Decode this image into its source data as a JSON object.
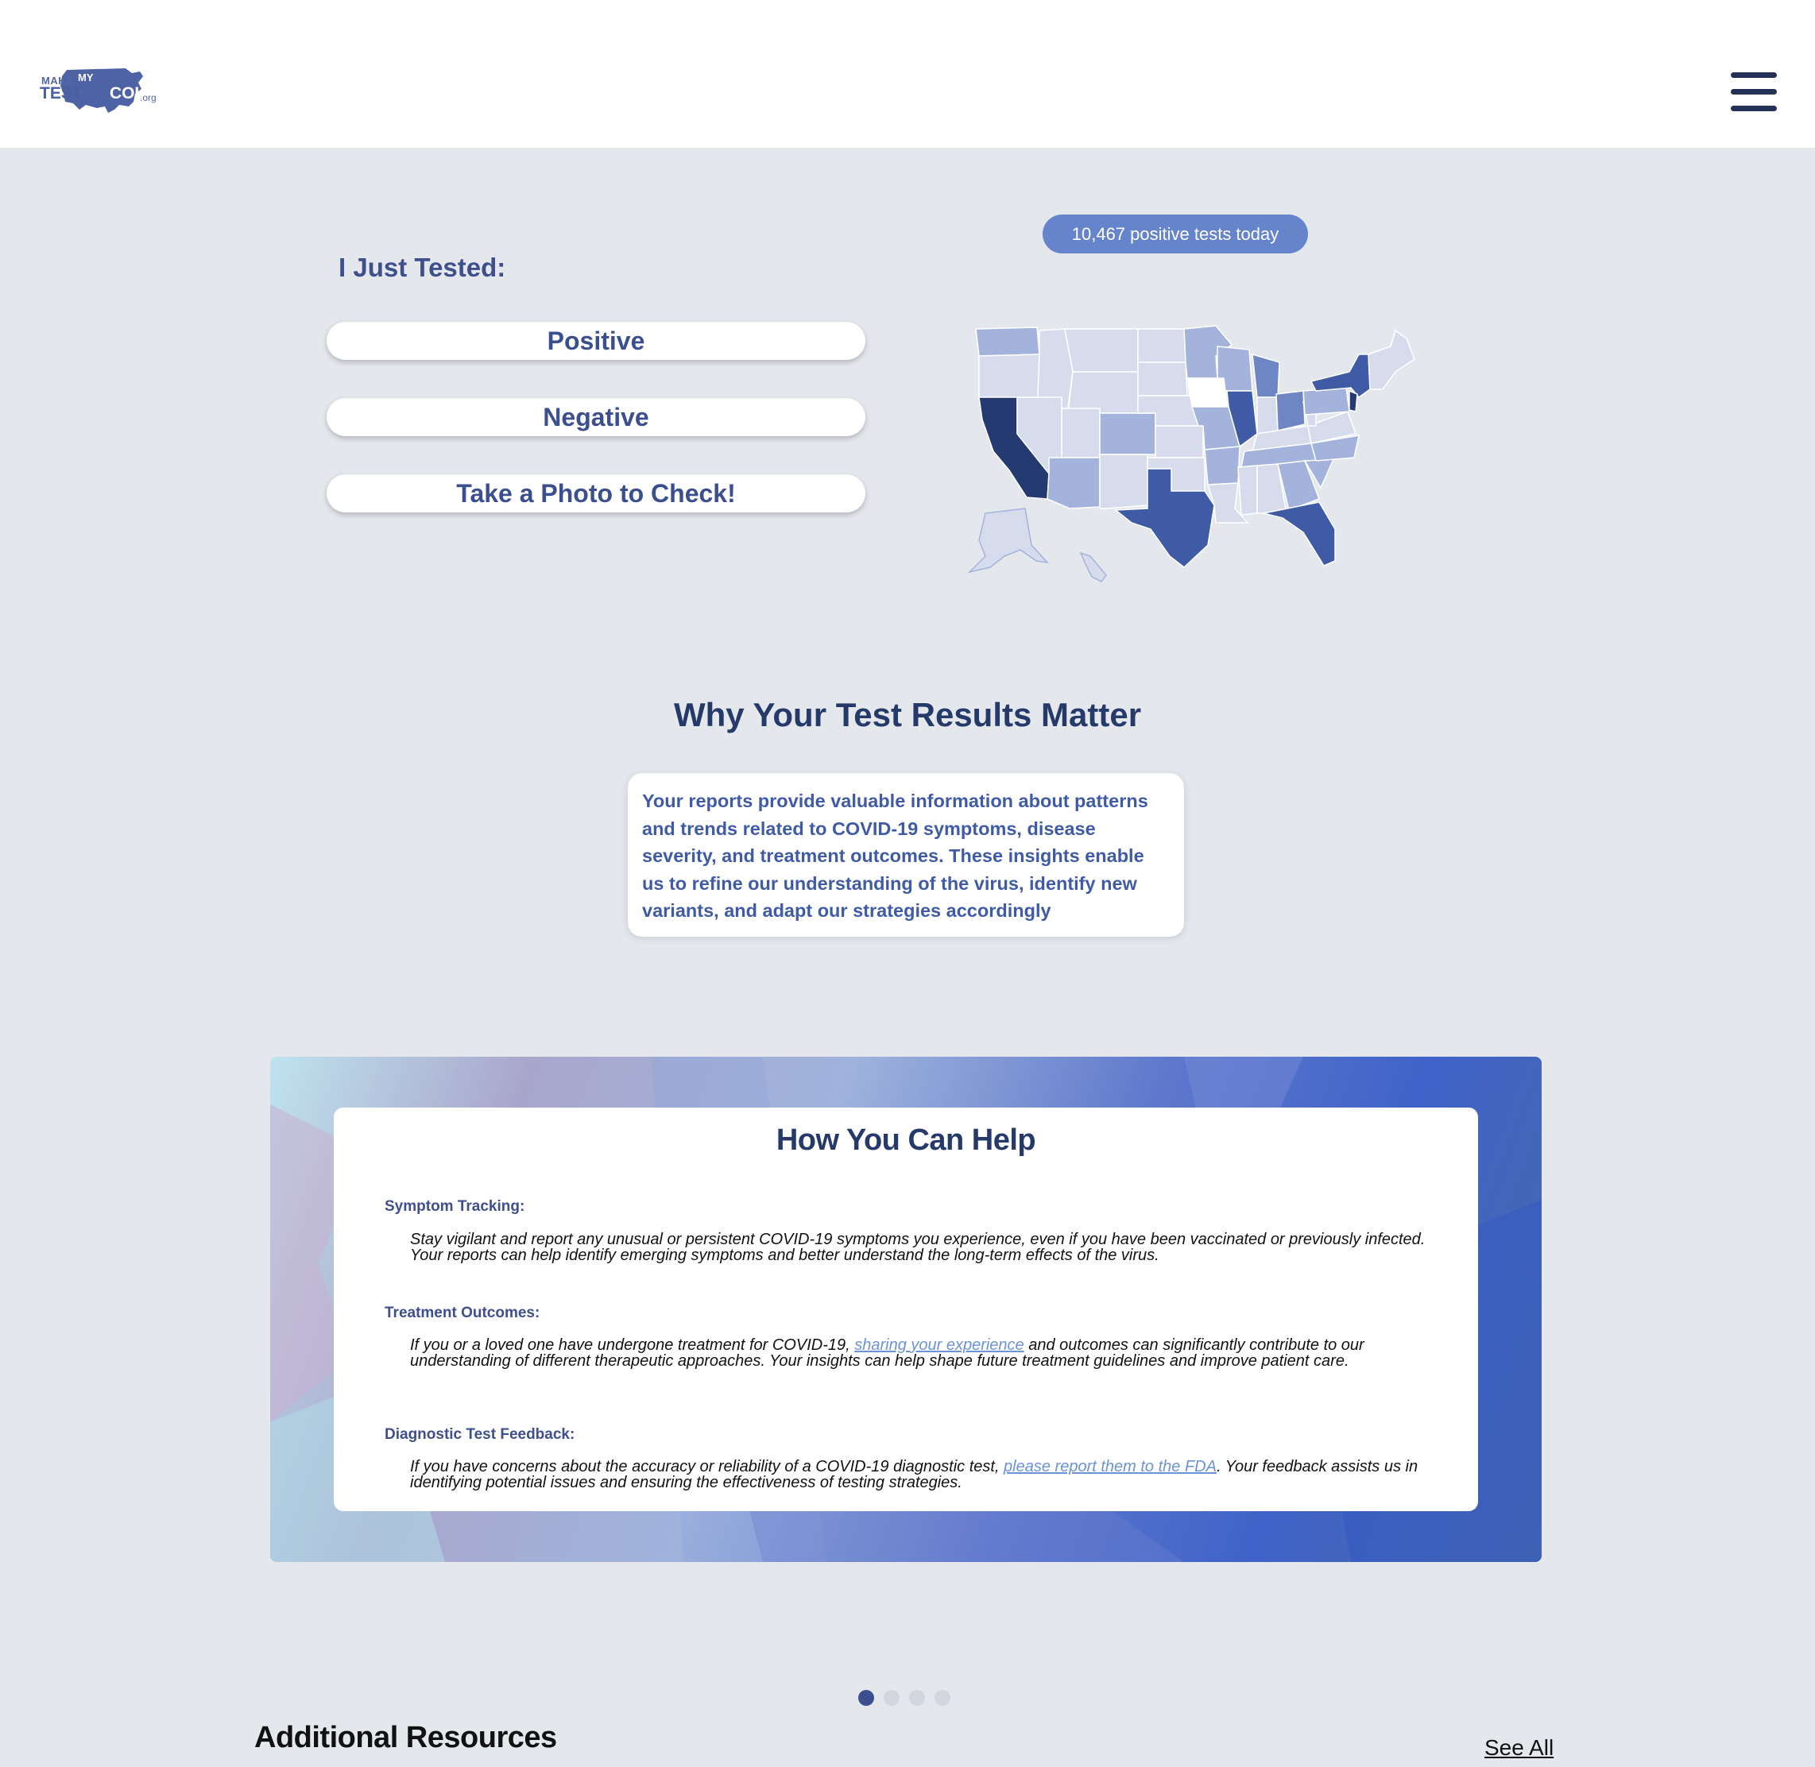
{
  "header": {
    "logo": {
      "line1": "MAKE",
      "line1b": "MY",
      "line2": "TEST",
      "line2b": "COUNT",
      "suffix": ".org"
    },
    "menu_icon": "hamburger-icon"
  },
  "hero": {
    "title": "I Just Tested:",
    "buttons": [
      "Positive",
      "Negative",
      "Take a Photo to Check!"
    ],
    "positive_badge": "10,467 positive tests today",
    "map_colors": {
      "darkest": "#243a70",
      "dark": "#3f5ba6",
      "mid": "#6f86c4",
      "light": "#a3b3db",
      "lightest": "#d6dceb"
    }
  },
  "why": {
    "title": "Why Your Test Results Matter",
    "body": "Your reports provide valuable information about patterns and trends related to COVID-19 symptoms, disease severity, and treatment outcomes. These insights enable us to refine our understanding of the virus, identify new variants, and adapt our strategies accordingly"
  },
  "help": {
    "title": "How You Can Help",
    "sections": [
      {
        "heading": "Symptom Tracking:",
        "text": "Stay vigilant and report any unusual or persistent COVID-19 symptoms you experience, even if you have been vaccinated or previously infected. Your reports can help identify emerging symptoms and better understand the long-term effects of the virus."
      },
      {
        "heading": "Treatment Outcomes:",
        "text_before": "If you or a loved one have undergone treatment for COVID-19, ",
        "link": "sharing your experience",
        "text_after": " and outcomes can significantly contribute to our understanding of different therapeutic approaches. Your insights can help shape future treatment guidelines and improve patient care."
      },
      {
        "heading": "Diagnostic Test Feedback:",
        "text_before": "If you have concerns about the accuracy or reliability of a COVID-19 diagnostic test, ",
        "link": "please report them to the FDA",
        "text_after": ". Your feedback assists us in identifying potential issues and ensuring the effectiveness of testing strategies."
      }
    ]
  },
  "carousel": {
    "count": 4,
    "active": 1
  },
  "resources": {
    "title": "Additional Resources",
    "see_all": "See All"
  }
}
